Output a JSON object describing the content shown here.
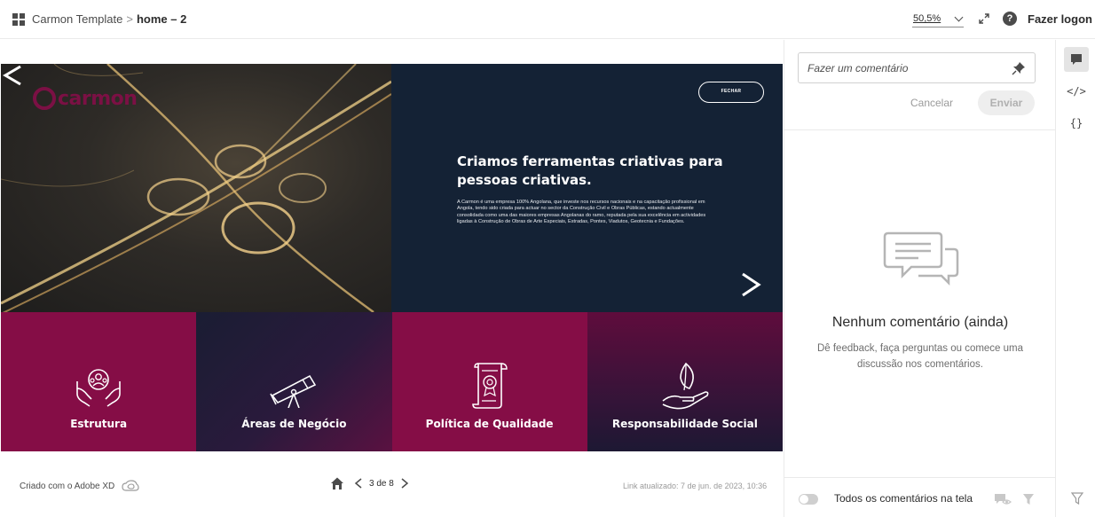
{
  "header": {
    "project": "Carmon Template",
    "separator": ">",
    "page": "home – 2",
    "zoom": "50,5%",
    "login": "Fazer logon"
  },
  "prototype": {
    "logo_text": "carmon",
    "close_label": "FECHAR",
    "hero_title": "Criamos ferramentas criativas para pessoas criativas.",
    "hero_body": "A Carmon é uma empresa 100% Angolana, que investe nos recursos nacionais e na capacitação profissional em Angola, tendo sido criada para actuar no sector da Construção Civil e Obras Públicas, estando actualmente consolidada como uma das maiores empresas Angolanas do ramo, reputada pela sua excelência em actividades ligadas à Construção de Obras de Arte Especiais, Estradas, Pontes, Viadutos, Geotecnia e Fundações.",
    "tiles": [
      {
        "label": "Estrutura",
        "icon": "team-hands-icon"
      },
      {
        "label": "Áreas de Negócio",
        "icon": "telescope-icon"
      },
      {
        "label": "Política de Qualidade",
        "icon": "certificate-scroll-icon"
      },
      {
        "label": "Responsabilidade Social",
        "icon": "hand-leaf-icon"
      }
    ],
    "colors": {
      "crimson": "#850d46",
      "navy": "#142235"
    }
  },
  "footer": {
    "made_with": "Criado com o Adobe XD",
    "page_counter": "3 de 8",
    "updated": "Link atualizado: 7 de jun. de 2023, 10:36"
  },
  "comments": {
    "placeholder": "Fazer um comentário",
    "cancel": "Cancelar",
    "send": "Enviar",
    "empty_title": "Nenhum comentário (ainda)",
    "empty_desc": "Dê feedback, faça perguntas ou comece uma discussão nos comentários.",
    "show_all_label": "Todos os comentários na tela"
  },
  "rail": {
    "code_label": "</>",
    "json_label": "{}"
  }
}
